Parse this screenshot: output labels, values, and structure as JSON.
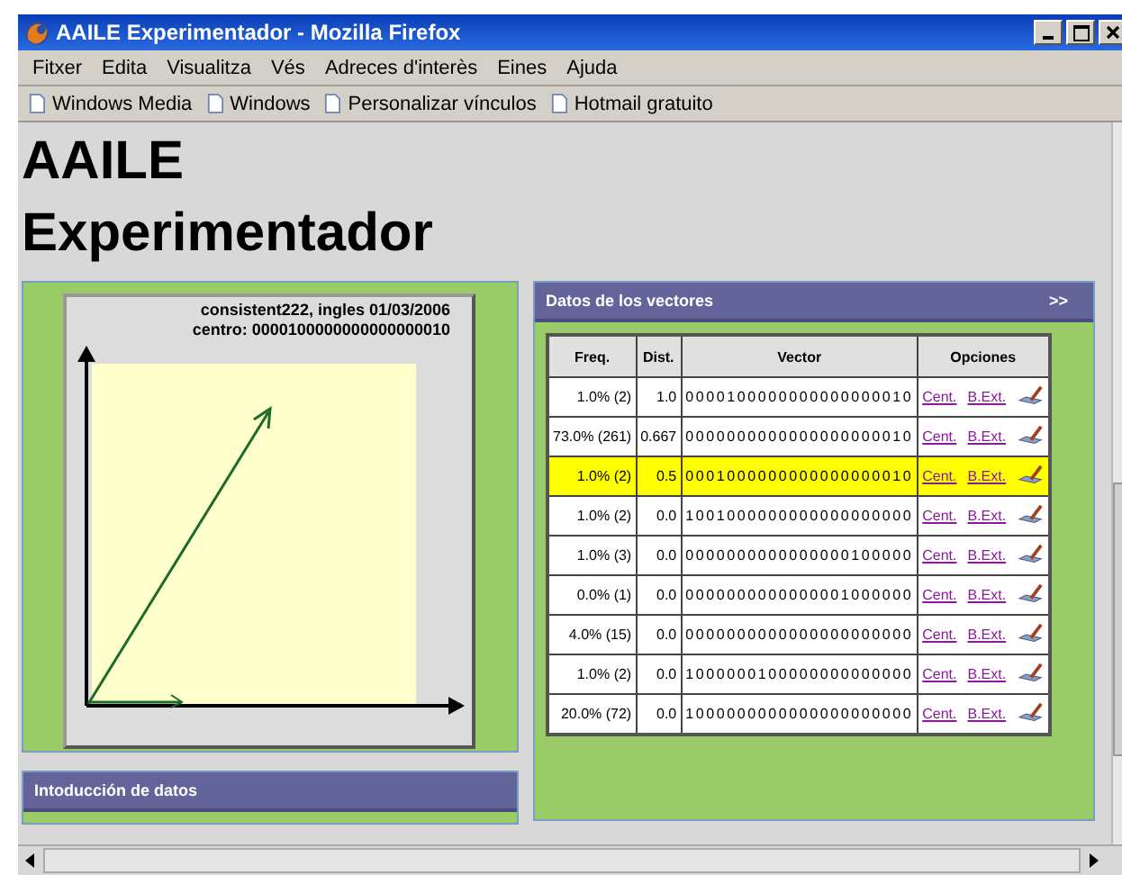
{
  "window": {
    "title": "AAILE Experimentador - Mozilla Firefox"
  },
  "menu": [
    "Fitxer",
    "Edita",
    "Visualitza",
    "Vés",
    "Adreces d'interès",
    "Eines",
    "Ajuda"
  ],
  "bookmarks": [
    "Windows Media",
    "Windows",
    "Personalizar vínculos",
    "Hotmail gratuito"
  ],
  "page": {
    "heading_lines": [
      "AAILE",
      "Experimentador"
    ],
    "plot": {
      "caption": "consistent222, ingles 01/03/2006",
      "center": "centro: 0000100000000000000010"
    },
    "input_panel": {
      "title": "Intoducción de datos"
    },
    "vectors_panel": {
      "title": "Datos de los vectores",
      "toggle": ">>",
      "columns": [
        "Freq.",
        "Dist.",
        "Vector",
        "Opciones"
      ],
      "rows": [
        {
          "freq": "1.0% (2)",
          "dist": "1.0",
          "vector": "0000100000000000000010",
          "links": [
            "Cent.",
            "B.Ext."
          ],
          "selected": false
        },
        {
          "freq": "73.0% (261)",
          "dist": "0.667",
          "vector": "0000000000000000000010",
          "links": [
            "Cent.",
            "B.Ext."
          ],
          "selected": false
        },
        {
          "freq": "1.0% (2)",
          "dist": "0.5",
          "vector": "0001000000000000000010",
          "links": [
            "Cent.",
            "B.Ext."
          ],
          "selected": true
        },
        {
          "freq": "1.0% (2)",
          "dist": "0.0",
          "vector": "1001000000000000000000",
          "links": [
            "Cent.",
            "B.Ext."
          ],
          "selected": false
        },
        {
          "freq": "1.0% (3)",
          "dist": "0.0",
          "vector": "0000000000000000100000",
          "links": [
            "Cent.",
            "B.Ext."
          ],
          "selected": false
        },
        {
          "freq": "0.0% (1)",
          "dist": "0.0",
          "vector": "0000000000000001000000",
          "links": [
            "Cent.",
            "B.Ext."
          ],
          "selected": false
        },
        {
          "freq": "4.0% (15)",
          "dist": "0.0",
          "vector": "0000000000000000000000",
          "links": [
            "Cent.",
            "B.Ext."
          ],
          "selected": false
        },
        {
          "freq": "1.0% (2)",
          "dist": "0.0",
          "vector": "1000000100000000000000",
          "links": [
            "Cent.",
            "B.Ext."
          ],
          "selected": false
        },
        {
          "freq": "20.0% (72)",
          "dist": "0.0",
          "vector": "1000000000000000000000",
          "links": [
            "Cent.",
            "B.Ext."
          ],
          "selected": false
        }
      ]
    }
  }
}
